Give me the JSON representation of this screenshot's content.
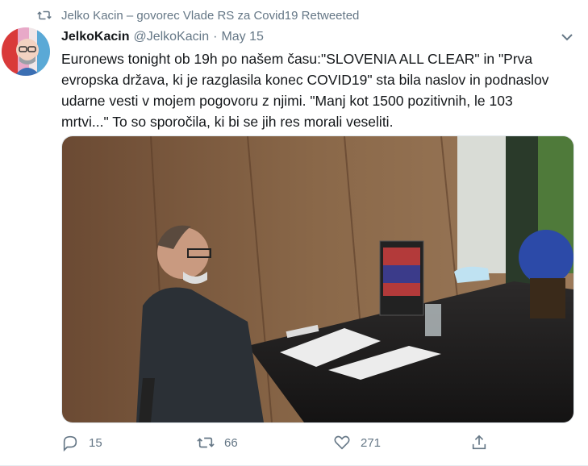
{
  "retweet": {
    "label": "Jelko Kacin – govorec Vlade RS za Covid19 Retweeted",
    "icon": "retweet-icon"
  },
  "tweet": {
    "name": "JelkoKacin",
    "handle": "@JelkoKacin",
    "dot": "·",
    "date": "May 15",
    "text": "Euronews tonight ob 19h po našem času:\"SLOVENIA ALL CLEAR\" in \"Prva evropska država, ki je razglasila konec COVID19\" sta bila naslov in podnaslov udarne vesti v mojem pogovoru z njimi. \"Manj kot 1500 pozitivnih, le 103 mrtvi...\" To so sporočila, ki bi se jih res morali veseliti."
  },
  "actions": {
    "replies": "15",
    "retweets": "66",
    "likes": "271"
  },
  "colors": {
    "secondary": "#657786",
    "text": "#14171a"
  }
}
